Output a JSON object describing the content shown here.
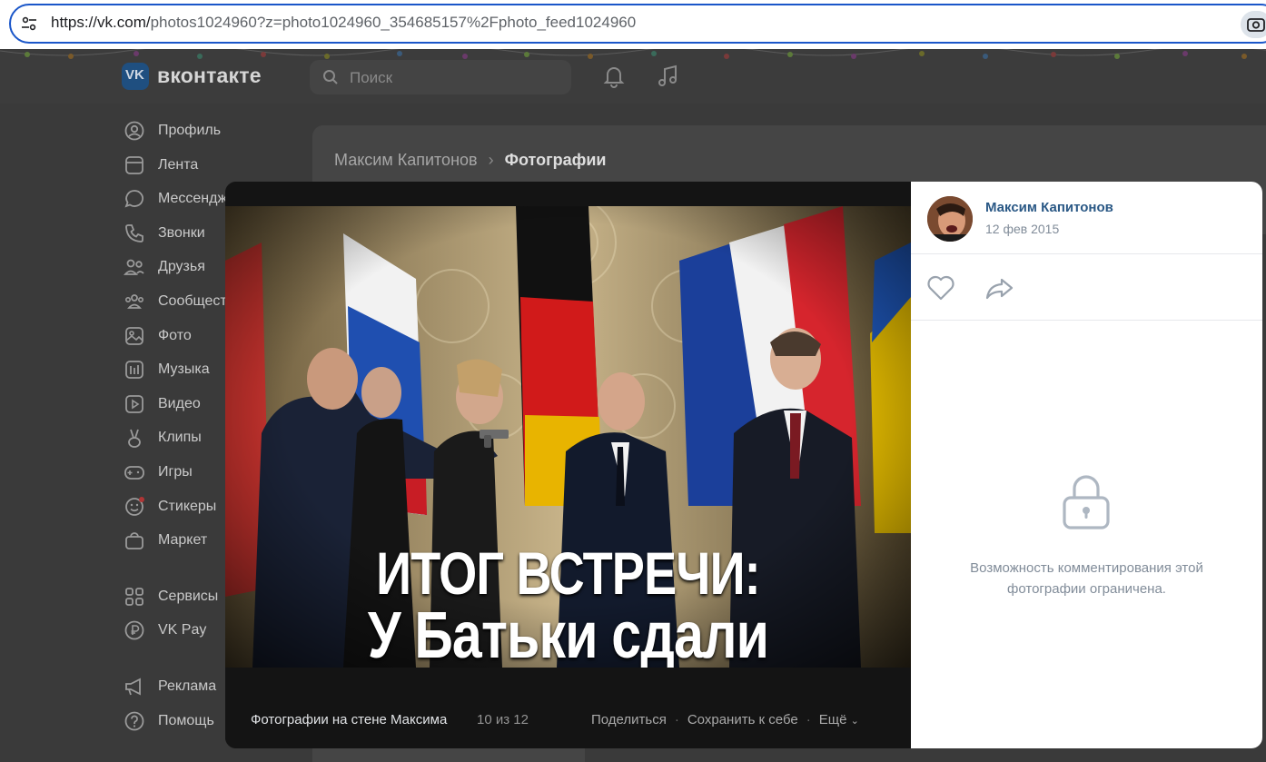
{
  "browser": {
    "url_host": "https://vk.com/",
    "url_path": "photos1024960?z=photo1024960_354685157%2Fphoto_feed1024960"
  },
  "header": {
    "logo_glyph": "VK",
    "logo_text": "вконтакте",
    "search_placeholder": "Поиск"
  },
  "sidebar": {
    "items": [
      {
        "label": "Профиль",
        "icon": "profile-icon"
      },
      {
        "label": "Лента",
        "icon": "feed-icon"
      },
      {
        "label": "Мессенджер",
        "icon": "messenger-icon"
      },
      {
        "label": "Звонки",
        "icon": "phone-icon"
      },
      {
        "label": "Друзья",
        "icon": "friends-icon"
      },
      {
        "label": "Сообщества",
        "icon": "communities-icon"
      },
      {
        "label": "Фото",
        "icon": "photo-icon"
      },
      {
        "label": "Музыка",
        "icon": "music-icon"
      },
      {
        "label": "Видео",
        "icon": "video-icon"
      },
      {
        "label": "Клипы",
        "icon": "clips-icon"
      },
      {
        "label": "Игры",
        "icon": "games-icon"
      },
      {
        "label": "Стикеры",
        "icon": "stickers-icon"
      },
      {
        "label": "Маркет",
        "icon": "market-icon"
      }
    ],
    "secondary": [
      {
        "label": "Сервисы",
        "icon": "services-icon"
      },
      {
        "label": "VK Pay",
        "icon": "vkpay-icon"
      }
    ],
    "tertiary": [
      {
        "label": "Реклама",
        "icon": "ads-icon"
      },
      {
        "label": "Помощь",
        "icon": "help-icon"
      }
    ]
  },
  "breadcrumb": {
    "parent": "Максим Капитонов",
    "current": "Фотографии"
  },
  "viewer": {
    "caption_line1": "ИТОГ ВСТРЕЧИ:",
    "caption_line2": "У Батьки сдали нервы...",
    "album": "Фотографии на стене Максима",
    "counter": "10 из 12",
    "share": "Поделиться",
    "save": "Сохранить к себе",
    "more": "Ещё",
    "author_name": "Максим Капитонов",
    "author_date": "12 фев 2015",
    "comments_locked": "Возможность комментирования этой фотографии ограничена."
  },
  "colors": {
    "accent_blue": "#2a5885",
    "muted": "#818c99",
    "overlay": "#141414"
  }
}
